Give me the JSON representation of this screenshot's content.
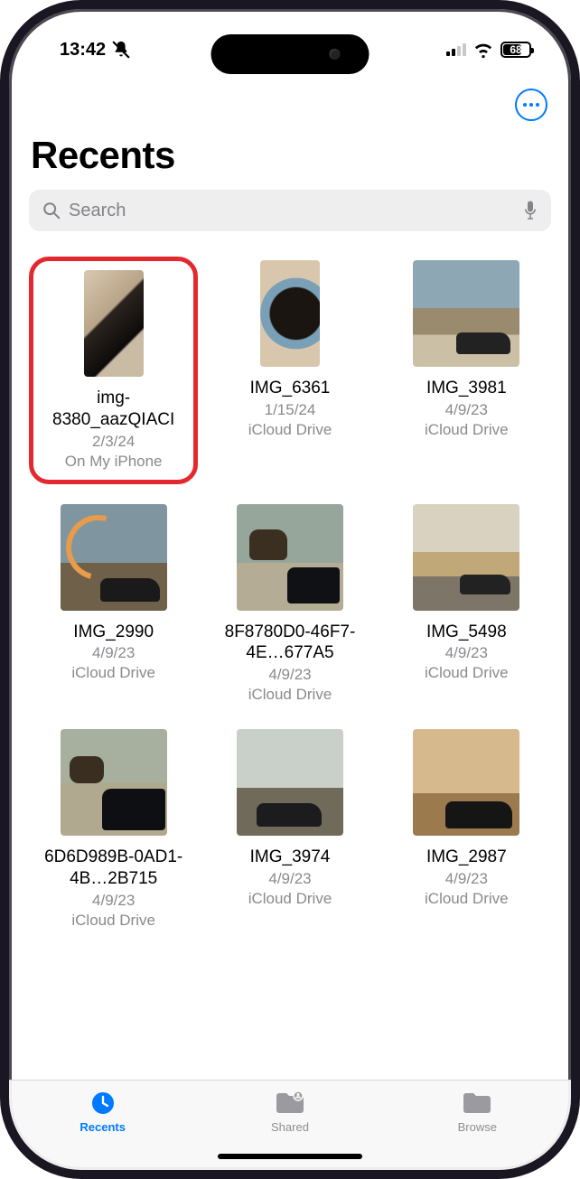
{
  "status": {
    "time": "13:42",
    "battery": "68"
  },
  "header": {
    "title": "Recents"
  },
  "search": {
    "placeholder": "Search"
  },
  "files": [
    {
      "name": "img-8380_aazQIACI",
      "date": "2/3/24",
      "location": "On My iPhone",
      "thumb": "th-cat1",
      "portrait": true,
      "highlighted": true
    },
    {
      "name": "IMG_6361",
      "date": "1/15/24",
      "location": "iCloud Drive",
      "thumb": "th-cat2",
      "portrait": true,
      "highlighted": false
    },
    {
      "name": "IMG_3981",
      "date": "4/9/23",
      "location": "iCloud Drive",
      "thumb": "th-car-mtn",
      "portrait": false,
      "highlighted": false
    },
    {
      "name": "IMG_2990",
      "date": "4/9/23",
      "location": "iCloud Drive",
      "thumb": "th-rainbow",
      "portrait": false,
      "highlighted": false
    },
    {
      "name": "8F8780D0-46F7-4E…677A5",
      "date": "4/9/23",
      "location": "iCloud Drive",
      "thumb": "th-bison",
      "portrait": false,
      "highlighted": false
    },
    {
      "name": "IMG_5498",
      "date": "4/9/23",
      "location": "iCloud Drive",
      "thumb": "th-road",
      "portrait": false,
      "highlighted": false
    },
    {
      "name": "6D6D989B-0AD1-4B…2B715",
      "date": "4/9/23",
      "location": "iCloud Drive",
      "thumb": "th-bison2",
      "portrait": false,
      "highlighted": false
    },
    {
      "name": "IMG_3974",
      "date": "4/9/23",
      "location": "iCloud Drive",
      "thumb": "th-jump",
      "portrait": false,
      "highlighted": false
    },
    {
      "name": "IMG_2987",
      "date": "4/9/23",
      "location": "iCloud Drive",
      "thumb": "th-desert",
      "portrait": false,
      "highlighted": false
    }
  ],
  "tabs": {
    "recents": "Recents",
    "shared": "Shared",
    "browse": "Browse"
  }
}
